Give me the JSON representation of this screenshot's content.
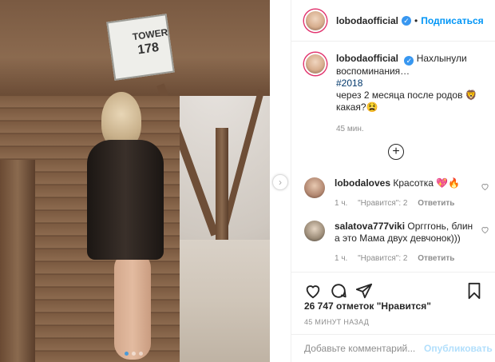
{
  "header": {
    "username": "lobodaofficial",
    "follow_label": "Подписаться",
    "separator": "•"
  },
  "photo": {
    "sign_line1": "TOWER",
    "sign_line2": "178",
    "carousel_total": 3,
    "carousel_active": 1
  },
  "caption": {
    "username": "lobodaofficial",
    "line1": "Нахлынули воспоминания…",
    "hashtag": "#2018",
    "line2": "через 2 месяца после родов 🦁",
    "line3": "какая?😫",
    "time": "45 мин."
  },
  "comments": [
    {
      "username": "lobodaloves",
      "text": "Красотка 💖🔥",
      "time": "1 ч.",
      "likes": "\"Нравится\": 2",
      "reply": "Ответить"
    },
    {
      "username": "salatova777viki",
      "text": "Оргггонь, блин а это Мама двух девчонок)))",
      "time": "1 ч.",
      "likes": "\"Нравится\": 2",
      "reply": "Ответить"
    }
  ],
  "likes_text": "26 747 отметок \"Нравится\"",
  "post_time": "45 МИНУТ НАЗАД",
  "add_comment": {
    "placeholder": "Добавьте комментарий...",
    "publish_label": "Опубликовать"
  },
  "colors": {
    "accent": "#0095f6",
    "verified": "#3897f0",
    "muted": "#8e8e8e"
  },
  "icons": [
    "verified-icon",
    "heart-icon",
    "comment-icon",
    "share-icon",
    "bookmark-icon",
    "plus-circle-icon",
    "chevron-right-icon"
  ]
}
